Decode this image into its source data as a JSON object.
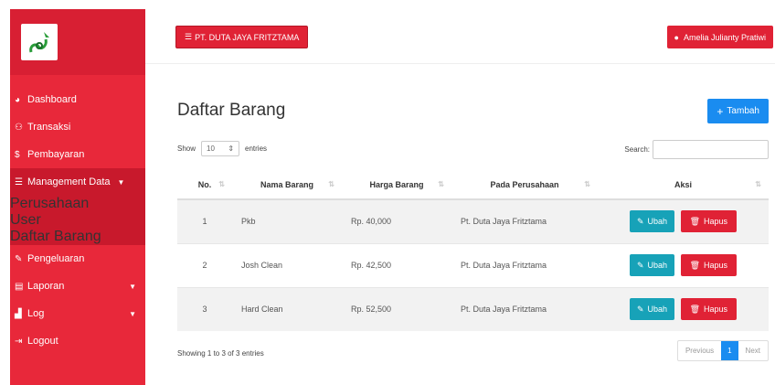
{
  "sidebar": {
    "logo": "logo-icon",
    "items": [
      {
        "icon": "dashboard-icon",
        "glyph": "◕",
        "label": "Dashboard"
      },
      {
        "icon": "transaksi-icon",
        "glyph": "⚇",
        "label": "Transaksi"
      },
      {
        "icon": "dollar-icon",
        "glyph": "$",
        "label": "Pembayaran"
      },
      {
        "icon": "list-icon",
        "glyph": "☰",
        "label": "Management Data"
      },
      {
        "icon": "edit-icon",
        "glyph": "✎",
        "label": "Pengeluaran"
      },
      {
        "icon": "file-icon",
        "glyph": "▤",
        "label": "Laporan"
      },
      {
        "icon": "chart-icon",
        "glyph": "▟",
        "label": "Log"
      },
      {
        "icon": "logout-icon",
        "glyph": "⇥",
        "label": "Logout"
      }
    ],
    "submenu": [
      "Perusahaan",
      "User",
      "Daftar Barang"
    ]
  },
  "topbar": {
    "company": "PT. DUTA JAYA FRITZTAMA",
    "user": "Amelia Julianty Pratiwi"
  },
  "main": {
    "title": "Daftar Barang",
    "add_label": "Tambah",
    "show_label": "Show",
    "entries_value": "10",
    "entries_label": "entries",
    "search_label": "Search:",
    "search_value": "",
    "columns": [
      "No.",
      "Nama Barang",
      "Harga Barang",
      "Pada Perusahaan",
      "Aksi"
    ],
    "rows": [
      {
        "no": "1",
        "nama": "Pkb",
        "harga": "Rp. 40,000",
        "perusahaan": "Pt. Duta Jaya Fritztama"
      },
      {
        "no": "2",
        "nama": "Josh Clean",
        "harga": "Rp. 42,500",
        "perusahaan": "Pt. Duta Jaya Fritztama"
      },
      {
        "no": "3",
        "nama": "Hard Clean",
        "harga": "Rp. 52,500",
        "perusahaan": "Pt. Duta Jaya Fritztama"
      }
    ],
    "ubah_label": "Ubah",
    "hapus_label": "Hapus",
    "info": "Showing 1 to 3 of 3 entries",
    "pager": {
      "prev": "Previous",
      "page": "1",
      "next": "Next"
    }
  },
  "colors": {
    "sidebar": "#e8283a",
    "primary_red": "#e02235",
    "info_teal": "#17a2b8",
    "primary_blue": "#1a8cf0"
  }
}
